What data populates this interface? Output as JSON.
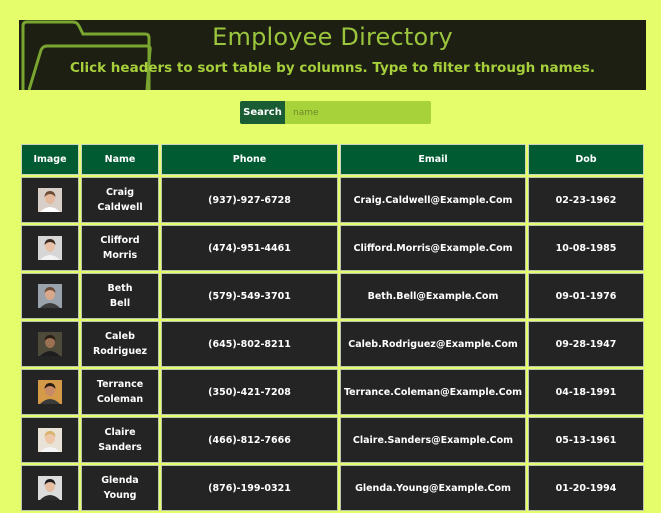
{
  "header": {
    "title": "Employee Directory",
    "subtitle": "Click headers to sort table by columns. Type to filter through names."
  },
  "search": {
    "label": "Search",
    "placeholder": "name",
    "value": ""
  },
  "table": {
    "columns": [
      "Image",
      "Name",
      "Phone",
      "Email",
      "Dob"
    ],
    "rows": [
      {
        "first": "Craig",
        "last": "Caldwell",
        "phone": "(937)-927-6728",
        "email": "Craig.Caldwell@Example.Com",
        "dob": "02-23-1962",
        "avatar": "person-photo"
      },
      {
        "first": "Clifford",
        "last": "Morris",
        "phone": "(474)-951-4461",
        "email": "Clifford.Morris@Example.Com",
        "dob": "10-08-1985",
        "avatar": "person-photo"
      },
      {
        "first": "Beth",
        "last": "Bell",
        "phone": "(579)-549-3701",
        "email": "Beth.Bell@Example.Com",
        "dob": "09-01-1976",
        "avatar": "person-photo"
      },
      {
        "first": "Caleb",
        "last": "Rodriguez",
        "phone": "(645)-802-8211",
        "email": "Caleb.Rodriguez@Example.Com",
        "dob": "09-28-1947",
        "avatar": "person-photo"
      },
      {
        "first": "Terrance",
        "last": "Coleman",
        "phone": "(350)-421-7208",
        "email": "Terrance.Coleman@Example.Com",
        "dob": "04-18-1991",
        "avatar": "person-photo"
      },
      {
        "first": "Claire",
        "last": "Sanders",
        "phone": "(466)-812-7666",
        "email": "Claire.Sanders@Example.Com",
        "dob": "05-13-1961",
        "avatar": "person-photo"
      },
      {
        "first": "Glenda",
        "last": "Young",
        "phone": "(876)-199-0321",
        "email": "Glenda.Young@Example.Com",
        "dob": "01-20-1994",
        "avatar": "person-photo"
      }
    ]
  },
  "colors": {
    "page_background": "#e6fd6b",
    "header_background": "#1c1f11",
    "title_color": "#9bc53d",
    "table_header": "#005a32",
    "row_background": "#242424"
  }
}
